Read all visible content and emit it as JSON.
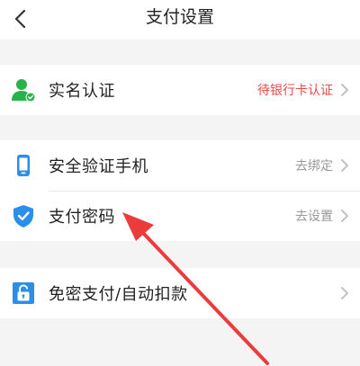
{
  "header": {
    "title": "支付设置",
    "back_icon": "back-icon"
  },
  "colors": {
    "green": "#27b34a",
    "blue": "#2b8ee8",
    "red": "#f04848",
    "annotation": "#ec3b3b"
  },
  "sections": {
    "identity": {
      "label": "实名认证",
      "value": "待银行卡认证",
      "icon": "user-verified-icon"
    },
    "security": {
      "phone": {
        "label": "安全验证手机",
        "value": "去绑定",
        "icon": "phone-icon"
      },
      "password": {
        "label": "支付密码",
        "value": "去设置",
        "icon": "shield-check-icon"
      }
    },
    "pay": {
      "label": "免密支付/自动扣款",
      "icon": "unlock-icon"
    }
  },
  "annotation": {
    "type": "red-arrow",
    "target": "支付密码"
  }
}
